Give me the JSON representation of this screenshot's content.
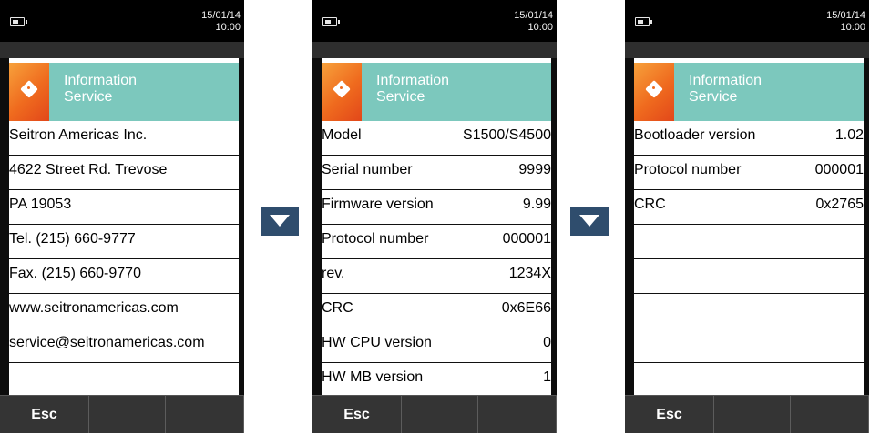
{
  "screens": [
    {
      "date": "15/01/14",
      "time": "10:00",
      "header": {
        "line1": "Information",
        "line2": "Service"
      },
      "rows": [
        {
          "label": "Seitron Americas Inc.",
          "value": ""
        },
        {
          "label": "4622 Street Rd. Trevose",
          "value": ""
        },
        {
          "label": "PA 19053",
          "value": ""
        },
        {
          "label": "Tel. (215) 660-9777",
          "value": ""
        },
        {
          "label": "Fax. (215) 660-9770",
          "value": ""
        },
        {
          "label": "www.seitronamericas.com",
          "value": ""
        },
        {
          "label": "service@seitronamericas.com",
          "value": ""
        },
        {
          "label": "",
          "value": ""
        }
      ],
      "softkeys": [
        "Esc",
        "",
        ""
      ]
    },
    {
      "date": "15/01/14",
      "time": "10:00",
      "header": {
        "line1": "Information",
        "line2": "Service"
      },
      "rows": [
        {
          "label": "Model",
          "value": "S1500/S4500"
        },
        {
          "label": "Serial number",
          "value": "9999"
        },
        {
          "label": "Firmware version",
          "value": "9.99"
        },
        {
          "label": "Protocol number",
          "value": "000001"
        },
        {
          "label": "rev.",
          "value": "1234X"
        },
        {
          "label": "CRC",
          "value": "0x6E66"
        },
        {
          "label": "HW CPU version",
          "value": "0"
        },
        {
          "label": "HW MB version",
          "value": "1"
        }
      ],
      "softkeys": [
        "Esc",
        "",
        ""
      ]
    },
    {
      "date": "15/01/14",
      "time": "10:00",
      "header": {
        "line1": "Information",
        "line2": "Service"
      },
      "rows": [
        {
          "label": "Bootloader version",
          "value": "1.02"
        },
        {
          "label": "Protocol number",
          "value": "000001"
        },
        {
          "label": "CRC",
          "value": "0x2765"
        },
        {
          "label": "",
          "value": ""
        },
        {
          "label": "",
          "value": ""
        },
        {
          "label": "",
          "value": ""
        },
        {
          "label": "",
          "value": ""
        },
        {
          "label": "",
          "value": ""
        }
      ],
      "softkeys": [
        "Esc",
        "",
        ""
      ]
    }
  ],
  "arrows": [
    {
      "icon": "arrow-down-icon"
    },
    {
      "icon": "arrow-down-icon"
    }
  ]
}
